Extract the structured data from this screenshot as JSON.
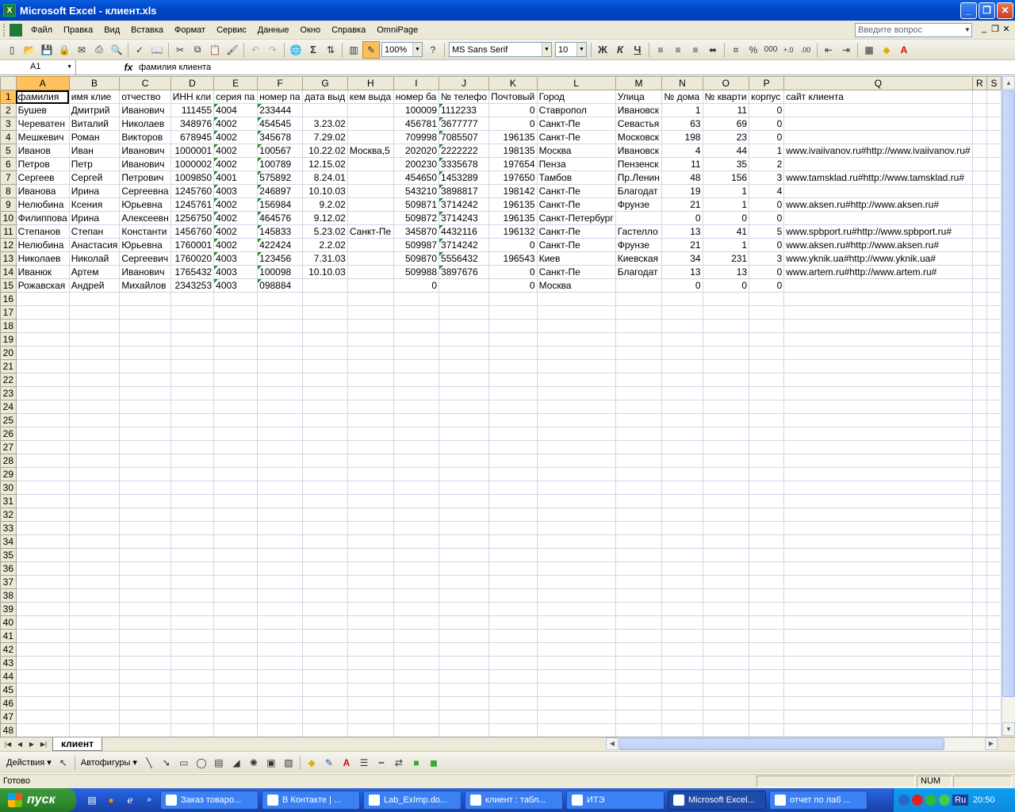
{
  "window": {
    "title": "Microsoft Excel - клиент.xls",
    "icon": "excel-icon"
  },
  "menu": [
    "Файл",
    "Правка",
    "Вид",
    "Вставка",
    "Формат",
    "Сервис",
    "Данные",
    "Окно",
    "Справка",
    "OmniPage"
  ],
  "ask_placeholder": "Введите вопрос",
  "toolbar": {
    "zoom": "100%",
    "font": "MS Sans Serif",
    "size": "10",
    "bold": "Ж",
    "italic": "К",
    "underline": "Ч",
    "percent": "%",
    "thousands": "000"
  },
  "formula_bar": {
    "cell_ref": "A1",
    "fx": "fx",
    "content": "фамилия  клиента"
  },
  "columns": [
    "A",
    "B",
    "C",
    "D",
    "E",
    "F",
    "G",
    "H",
    "I",
    "J",
    "K",
    "L",
    "M",
    "N",
    "O",
    "P",
    "Q",
    "R",
    "S"
  ],
  "rows": [
    [
      "фамилия",
      "имя  клие",
      "отчество",
      "ИНН  кли",
      "серия  па",
      "номер па",
      "дата  выд",
      "кем выда",
      "номер ба",
      "№ телефо",
      "Почтовый",
      "Город",
      "Улица",
      "№ дома",
      "№  кварти",
      "корпус",
      "сайт клиента",
      "",
      ""
    ],
    [
      "Бушев",
      "Дмитрий",
      "Иванович",
      "111455",
      "4004",
      "233444",
      "",
      "",
      "100009",
      "1112233",
      "0",
      "Ставропол",
      "Ивановск",
      "1",
      "11",
      "0",
      "",
      "",
      ""
    ],
    [
      "Череватен",
      "Виталий",
      "Николаев",
      "348976",
      "4002",
      "454545",
      "3.23.02",
      "",
      "456781",
      "3677777",
      "0",
      "Санкт-Пе",
      "Севастья",
      "63",
      "69",
      "0",
      "",
      "",
      ""
    ],
    [
      "Мешкевич",
      "Роман",
      "Викторов",
      "678945",
      "4002",
      "345678",
      "7.29.02",
      "",
      "709998",
      "7085507",
      "196135",
      "Санкт-Пе",
      "Московск",
      "198",
      "23",
      "0",
      "",
      "",
      ""
    ],
    [
      "Иванов",
      "Иван",
      "Иванович",
      "1000001",
      "4002",
      "100567",
      "10.22.02",
      "Москва,5",
      "202020",
      "2222222",
      "198135",
      "Москва",
      "Ивановск",
      "4",
      "44",
      "1",
      "www.ivaiivanov.ru#http://www.ivaiivanov.ru#",
      "",
      ""
    ],
    [
      "Петров",
      "Петр",
      "Иванович",
      "1000002",
      "4002",
      "100789",
      "12.15.02",
      "",
      "200230",
      "3335678",
      "197654",
      "Пенза",
      "Пензенск",
      "11",
      "35",
      "2",
      "",
      "",
      ""
    ],
    [
      "Сергеев",
      "Сергей",
      "Петрович",
      "1009850",
      "4001",
      "575892",
      "8.24.01",
      "",
      "454650",
      "1453289",
      "197650",
      "Тамбов",
      "Пр.Ленин",
      "48",
      "156",
      "3",
      "www.tamsklad.ru#http://www.tamsklad.ru#",
      "",
      ""
    ],
    [
      "Иванова",
      "Ирина",
      "Сергеевна",
      "1245760",
      "4003",
      "246897",
      "10.10.03",
      "",
      "543210",
      "3898817",
      "198142",
      "Санкт-Пе",
      "Благодат",
      "19",
      "1",
      "4",
      "",
      "",
      ""
    ],
    [
      "Нелюбина",
      "Ксения",
      "Юрьевна",
      "1245761",
      "4002",
      "156984",
      "9.2.02",
      "",
      "509871",
      "3714242",
      "196135",
      "Санкт-Пе",
      "Фрунзе",
      "21",
      "1",
      "0",
      "www.aksen.ru#http://www.aksen.ru#",
      "",
      ""
    ],
    [
      "Филиппова",
      "Ирина",
      "Алексеевн",
      "1256750",
      "4002",
      "464576",
      "9.12.02",
      "",
      "509872",
      "3714243",
      "196135",
      "Санкт-Петербург",
      "",
      "0",
      "0",
      "0",
      "",
      "",
      ""
    ],
    [
      "Степанов",
      "Степан",
      "Константи",
      "1456760",
      "4002",
      "145833",
      "5.23.02",
      "Санкт-Пе",
      "345870",
      "4432116",
      "196132",
      "Санкт-Пе",
      "Гастелло",
      "13",
      "41",
      "5",
      "www.spbport.ru#http://www.spbport.ru#",
      "",
      ""
    ],
    [
      "Нелюбина",
      "Анастасия",
      "Юрьевна",
      "1760001",
      "4002",
      "422424",
      "2.2.02",
      "",
      "509987",
      "3714242",
      "0",
      "Санкт-Пе",
      "Фрунзе",
      "21",
      "1",
      "0",
      "www.aksen.ru#http://www.aksen.ru#",
      "",
      ""
    ],
    [
      "Николаев",
      "Николай",
      "Сергеевич",
      "1760020",
      "4003",
      "123456",
      "7.31.03",
      "",
      "509870",
      "5556432",
      "196543",
      "Киев",
      "Киевская",
      "34",
      "231",
      "3",
      "www.yknik.ua#http://www.yknik.ua#",
      "",
      ""
    ],
    [
      "Иванюк",
      "Артем",
      "Иванович",
      "1765432",
      "4003",
      "100098",
      "10.10.03",
      "",
      "509988",
      "3897676",
      "0",
      "Санкт-Пе",
      "Благодат",
      "13",
      "13",
      "0",
      "www.artem.ru#http://www.artem.ru#",
      "",
      ""
    ],
    [
      "Рожавская",
      "Андрей",
      "Михайлов",
      "2343253",
      "4003",
      "098884",
      "",
      "",
      "0",
      "",
      "0",
      "Москва",
      "",
      "0",
      "0",
      "0",
      "",
      "",
      ""
    ]
  ],
  "total_rows": 48,
  "sheet_tab": "клиент",
  "drawing": {
    "actions": "Действия",
    "autoshapes": "Автофигуры"
  },
  "status": {
    "ready": "Готово",
    "num": "NUM"
  },
  "taskbar": {
    "start": "пуск",
    "tasks": [
      {
        "label": "Заказ товаро...",
        "icon": "browser-icon"
      },
      {
        "label": "В Контакте | ...",
        "icon": "browser-icon"
      },
      {
        "label": "Lab_ExImp.do...",
        "icon": "word-icon"
      },
      {
        "label": "клиент : табл...",
        "icon": "table-icon"
      },
      {
        "label": "ИТЭ",
        "icon": "folder-icon"
      },
      {
        "label": "Microsoft Excel...",
        "icon": "excel-icon"
      },
      {
        "label": "отчет по лаб ...",
        "icon": "word-icon"
      }
    ],
    "lang": "Ru",
    "clock": "20:50"
  }
}
